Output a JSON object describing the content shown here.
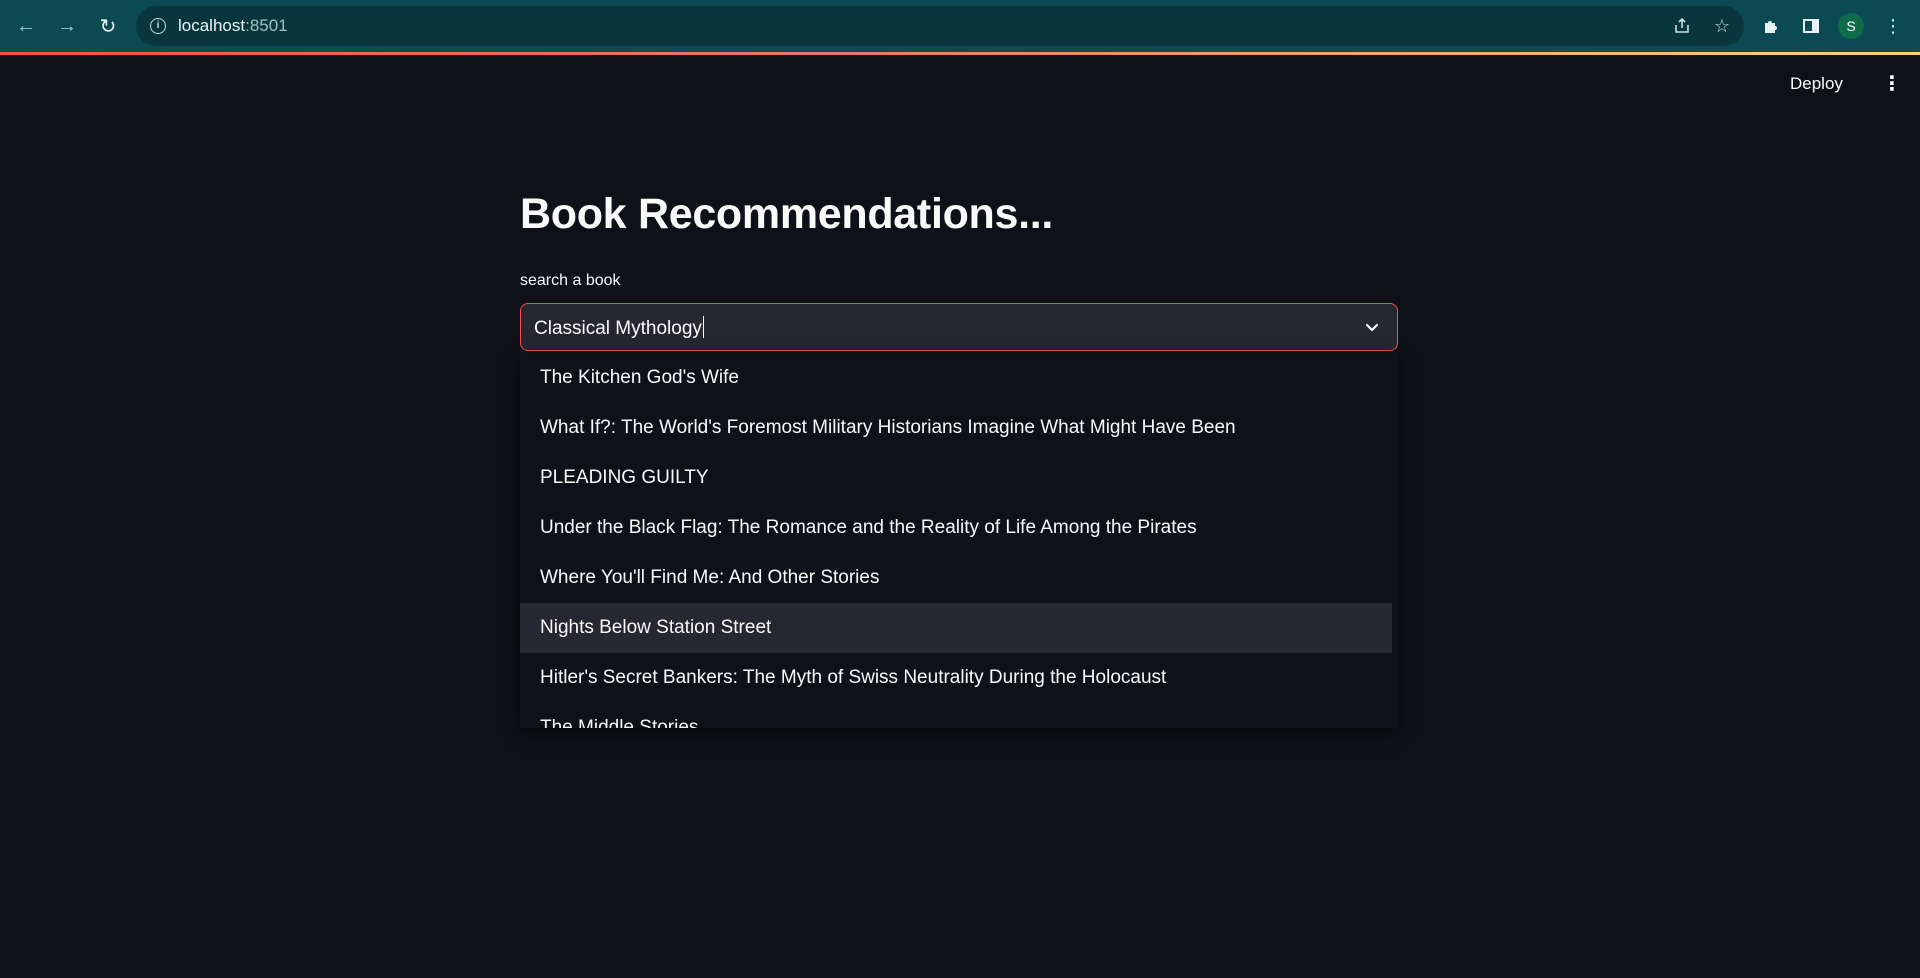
{
  "browser": {
    "url_host": "localhost",
    "url_port": ":8501",
    "avatar_letter": "S",
    "icons": [
      "back-icon",
      "forward-icon",
      "reload-icon",
      "info-icon",
      "share-icon",
      "star-icon",
      "puzzle-icon",
      "sidepanel-icon",
      "kebab-icon"
    ]
  },
  "app_header": {
    "deploy_label": "Deploy"
  },
  "main": {
    "title": "Book Recommendations...",
    "search_label": "search a book",
    "select_value": "Classical Mythology",
    "options": [
      "The Kitchen God's Wife",
      "What If?: The World's Foremost Military Historians Imagine What Might Have Been",
      "PLEADING GUILTY",
      "Under the Black Flag: The Romance and the Reality of Life Among the Pirates",
      "Where You'll Find Me: And Other Stories",
      "Nights Below Station Street",
      "Hitler's Secret Bankers: The Myth of Swiss Neutrality During the Holocaust",
      "The Middle Stories"
    ],
    "highlighted_option": "Nights Below Station Street"
  },
  "colors": {
    "background": "#0e1117",
    "input_bg": "#262730",
    "focus_border": "#ff4b4b",
    "chrome": "#0b4a52"
  }
}
